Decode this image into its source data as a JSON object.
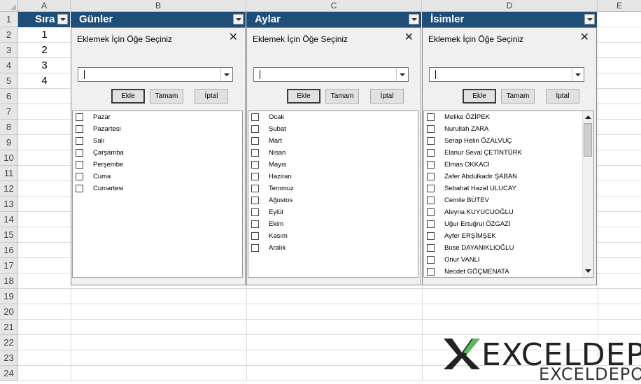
{
  "columns": [
    "A",
    "B",
    "C",
    "D",
    "E"
  ],
  "rows": [
    "1",
    "2",
    "3",
    "4",
    "5",
    "6",
    "7",
    "8",
    "9",
    "10",
    "11",
    "12",
    "13",
    "14",
    "15",
    "16",
    "17",
    "18",
    "19",
    "20",
    "21",
    "22",
    "23",
    "24"
  ],
  "table_headers": {
    "sira": "Sıra",
    "gunler": "Günler",
    "aylar": "Aylar",
    "isimler": "İsimler"
  },
  "sira_values": [
    "1",
    "2",
    "3",
    "4"
  ],
  "panel_common": {
    "title": "Eklemek İçin Öğe Seçiniz",
    "close": "✕",
    "combo_value": "",
    "btn_add": "Ekle",
    "btn_ok": "Tamam",
    "btn_cancel": "İptal"
  },
  "gunler_items": [
    "Pazar",
    "Pazartesi",
    "Salı",
    "Çarşamba",
    "Perşembe",
    "Cuma",
    "Cumartesi"
  ],
  "aylar_items": [
    "Ocak",
    "Şubat",
    "Mart",
    "Nisan",
    "Mayıs",
    "Haziran",
    "Temmuz",
    "Ağustos",
    "Eylül",
    "Ekim",
    "Kasım",
    "Aralık"
  ],
  "isimler_items": [
    "Melike ÖZİPEK",
    "Nurullah ZARA",
    "Serap Helin ÖZALVUÇ",
    "Elanur Seval ÇETİNTÜRK",
    "Elmas OKKACI",
    "Zafer Abdulkadir ŞABAN",
    "Sebahat Hazal ULUCAY",
    "Cemile BÜTEV",
    "Aleyna KUYUCUOĞLU",
    "Uğur Ertuğrul ÖZGAZİ",
    "Ayfer ERŞİMŞEK",
    "Buse DAYANIKLIOĞLU",
    "Onur VANLI",
    "Necdet GÖÇMENATA"
  ],
  "logo": {
    "main_text": "EXCELDEPO",
    "sub_text": "EXCELDEPO",
    "color_dark": "#222222",
    "color_green": "#5cb85c"
  },
  "colors": {
    "header_bg": "#1f4e79",
    "header_text": "#ffffff"
  }
}
